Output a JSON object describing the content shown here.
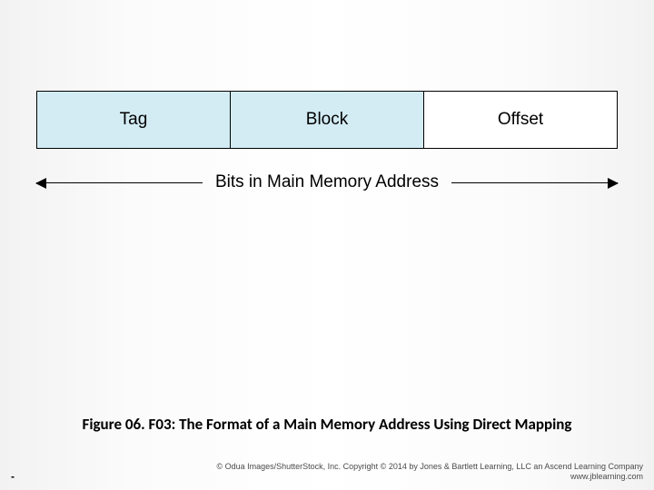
{
  "diagram": {
    "fields": [
      {
        "label": "Tag",
        "fill": "blue"
      },
      {
        "label": "Block",
        "fill": "blue"
      },
      {
        "label": "Offset",
        "fill": "white"
      }
    ],
    "extent_label": "Bits in Main Memory Address"
  },
  "caption": "Figure 06. F03: The Format of a Main Memory Address Using Direct Mapping",
  "footer": {
    "dash": "-",
    "copyright": "© Odua Images/ShutterStock, Inc. Copyright © 2014 by Jones & Bartlett Learning, LLC an Ascend Learning Company",
    "url": "www.jblearning.com"
  }
}
